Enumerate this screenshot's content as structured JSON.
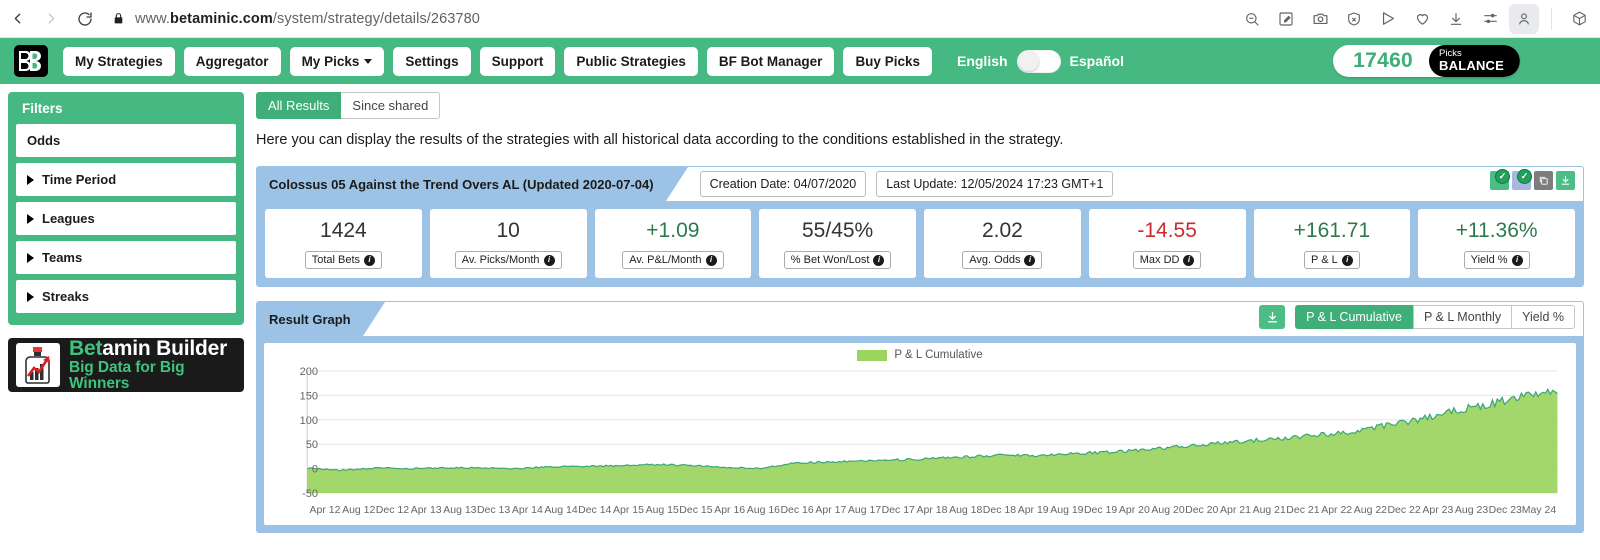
{
  "browser": {
    "url_prefix": "www.",
    "url_domain": "betaminic.com",
    "url_path": "/system/strategy/details/263780",
    "back_icon": "back-arrow-icon",
    "forward_icon": "forward-arrow-icon",
    "reload_icon": "reload-icon",
    "lock_icon": "lock-icon",
    "toolbar_icons": [
      "zoom-out-icon",
      "edit-page-icon",
      "camera-icon",
      "shield-icon",
      "send-icon",
      "heart-icon",
      "download-icon",
      "settings-sliders-icon",
      "profile-icon",
      "extension-cube-icon"
    ]
  },
  "appnav": {
    "logo": "betaminic-bb-logo",
    "items": [
      {
        "label": "My Strategies",
        "caret": false
      },
      {
        "label": "Aggregator",
        "caret": false
      },
      {
        "label": "My Picks",
        "caret": true
      },
      {
        "label": "Settings",
        "caret": false
      },
      {
        "label": "Support",
        "caret": false
      },
      {
        "label": "Public Strategies",
        "caret": false
      },
      {
        "label": "BF Bot Manager",
        "caret": false
      },
      {
        "label": "Buy Picks",
        "caret": false
      }
    ],
    "lang_left": "English",
    "lang_right": "Español",
    "balance_amount": "17460",
    "balance_tag_line1": "Picks",
    "balance_tag_line2": "BALANCE"
  },
  "sidebar": {
    "title": "Filters",
    "items": [
      {
        "label": "Odds",
        "caret": false
      },
      {
        "label": "Time Period",
        "caret": true
      },
      {
        "label": "Leagues",
        "caret": true
      },
      {
        "label": "Teams",
        "caret": true
      },
      {
        "label": "Streaks",
        "caret": true
      }
    ],
    "promo": {
      "icon": "bottle-chart-logo",
      "line1_a": "Bet",
      "line1_b": "amin Builder",
      "line2": "Big Data for Big Winners"
    }
  },
  "main": {
    "tabs": [
      {
        "label": "All Results",
        "active": true
      },
      {
        "label": "Since shared",
        "active": false
      }
    ],
    "blurb": "Here you can display the results of the strategies with all historical data according to the conditions established in the strategy.",
    "strategy": {
      "title": "Colossus 05 Against the Trend Overs AL (Updated 2020-07-04)",
      "creation_date": "Creation Date: 04/07/2020",
      "last_update": "Last Update: 12/05/2024 17:23 GMT+1",
      "head_icons": [
        "verified-green-icon",
        "verified-blue-icon",
        "copy-icon",
        "download-icon"
      ]
    },
    "stats": [
      {
        "value": "1424",
        "label": "Total Bets",
        "tone": "neutral"
      },
      {
        "value": "10",
        "label": "Av. Picks/Month",
        "tone": "neutral"
      },
      {
        "value": "+1.09",
        "label": "Av. P&L/Month",
        "tone": "pos"
      },
      {
        "value": "55/45%",
        "label": "% Bet Won/Lost",
        "tone": "neutral"
      },
      {
        "value": "2.02",
        "label": "Avg. Odds",
        "tone": "neutral"
      },
      {
        "value": "-14.55",
        "label": "Max DD",
        "tone": "neg"
      },
      {
        "value": "+161.71",
        "label": "P & L",
        "tone": "pos"
      },
      {
        "value": "+11.36%",
        "label": "Yield %",
        "tone": "pos"
      }
    ],
    "graph_panel": {
      "ribbon": "Result Graph",
      "download_icon": "download-icon",
      "buttons": [
        {
          "label": "P & L Cumulative",
          "active": true
        },
        {
          "label": "P & L Monthly",
          "active": false
        },
        {
          "label": "Yield %",
          "active": false
        }
      ]
    }
  },
  "chart_data": {
    "type": "area",
    "title": "",
    "legend": [
      "P & L Cumulative"
    ],
    "legend_position": "top-center",
    "series_color": "#9bd45f",
    "line_color": "#3aa67a",
    "grid": true,
    "xlabel": "",
    "ylabel": "",
    "ylim": [
      -50,
      200
    ],
    "yticks": [
      200,
      150,
      100,
      50,
      0,
      -50
    ],
    "categories": [
      "Apr 12",
      "Aug 12",
      "Dec 12",
      "Apr 13",
      "Aug 13",
      "Dec 13",
      "Apr 14",
      "Aug 14",
      "Dec 14",
      "Apr 15",
      "Aug 15",
      "Dec 15",
      "Apr 16",
      "Aug 16",
      "Dec 16",
      "Apr 17",
      "Aug 17",
      "Dec 17",
      "Apr 18",
      "Aug 18",
      "Dec 18",
      "Apr 19",
      "Aug 19",
      "Dec 19",
      "Apr 20",
      "Aug 20",
      "Dec 20",
      "Apr 21",
      "Aug 21",
      "Dec 21",
      "Apr 22",
      "Aug 22",
      "Dec 22",
      "Apr 23",
      "Aug 23",
      "Dec 23",
      "May 24"
    ],
    "series": [
      {
        "name": "P & L Cumulative",
        "values": [
          1,
          -3,
          1,
          0,
          2,
          1,
          0,
          4,
          5,
          6,
          8,
          7,
          3,
          0,
          11,
          14,
          16,
          18,
          20,
          24,
          28,
          27,
          31,
          33,
          38,
          44,
          50,
          56,
          62,
          68,
          75,
          88,
          100,
          118,
          132,
          148,
          162
        ]
      }
    ]
  }
}
